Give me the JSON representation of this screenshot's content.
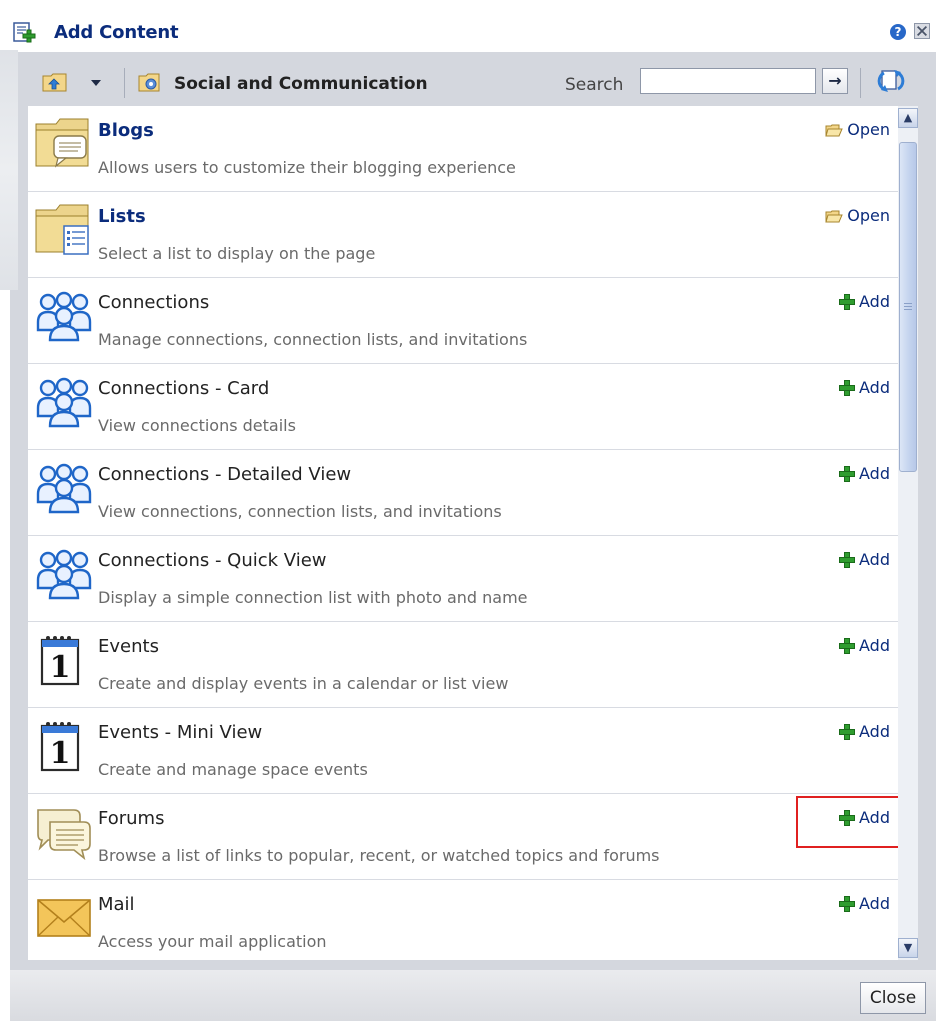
{
  "dialog": {
    "title": "Add Content",
    "help_icon": "?"
  },
  "toolbar": {
    "category": "Social and Communication",
    "search_label": "Search",
    "search_value": "",
    "go_symbol": "→"
  },
  "items": [
    {
      "name": "Blogs",
      "description": "Allows users to customize their blogging experience",
      "action": "Open",
      "icon": "folder-blog-icon",
      "bold": true
    },
    {
      "name": "Lists",
      "description": "Select a list to display on the page",
      "action": "Open",
      "icon": "folder-list-icon",
      "bold": true
    },
    {
      "name": "Connections",
      "description": "Manage connections, connection lists, and invitations",
      "action": "Add",
      "icon": "people-icon",
      "bold": false
    },
    {
      "name": "Connections - Card",
      "description": "View connections details",
      "action": "Add",
      "icon": "people-icon",
      "bold": false
    },
    {
      "name": "Connections - Detailed View",
      "description": "View connections, connection lists, and invitations",
      "action": "Add",
      "icon": "people-icon",
      "bold": false
    },
    {
      "name": "Connections - Quick View",
      "description": "Display a simple connection list with photo and name",
      "action": "Add",
      "icon": "people-icon",
      "bold": false
    },
    {
      "name": "Events",
      "description": "Create and display events in a calendar or list view",
      "action": "Add",
      "icon": "calendar-icon",
      "calendar_digit": "1",
      "bold": false
    },
    {
      "name": "Events - Mini View",
      "description": "Create and manage space events",
      "action": "Add",
      "icon": "calendar-icon",
      "calendar_digit": "1",
      "bold": false
    },
    {
      "name": "Forums",
      "description": "Browse a list of links to popular, recent, or watched topics and forums",
      "action": "Add",
      "icon": "forum-icon",
      "bold": false,
      "highlighted": true
    },
    {
      "name": "Mail",
      "description": "Access your mail application",
      "action": "Add",
      "icon": "mail-icon",
      "bold": false
    }
  ],
  "footer": {
    "close_label": "Close"
  },
  "colors": {
    "link": "#0b2c7c",
    "highlight": "#e02020",
    "add_plus": "#2f9d2f"
  }
}
